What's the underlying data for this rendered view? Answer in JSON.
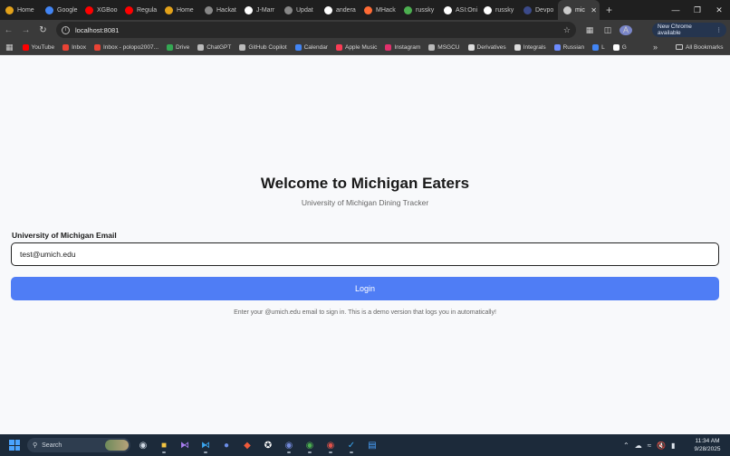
{
  "browser": {
    "tabs": [
      {
        "label": "Home",
        "color": "#e3a21a"
      },
      {
        "label": "Google",
        "color": "#4285f4"
      },
      {
        "label": "XGBoo",
        "color": "#ff0000"
      },
      {
        "label": "Regula",
        "color": "#ff0000"
      },
      {
        "label": "Home",
        "color": "#e3a21a"
      },
      {
        "label": "Hackat",
        "color": "#888888"
      },
      {
        "label": "J-Marr",
        "color": "#ffffff"
      },
      {
        "label": "Updat",
        "color": "#888888"
      },
      {
        "label": "andera",
        "color": "#ffffff"
      },
      {
        "label": "MHack",
        "color": "#ff6b35"
      },
      {
        "label": "russky",
        "color": "#4caf50"
      },
      {
        "label": "ASI:Oni",
        "color": "#ffffff"
      },
      {
        "label": "russky",
        "color": "#ffffff"
      },
      {
        "label": "Devpo",
        "color": "#3b4a8a"
      },
      {
        "label": "mic",
        "color": "#cccccc"
      }
    ],
    "url": "localhost:8081",
    "profile_initial": "A",
    "update_label": "New Chrome available",
    "bookmarks": [
      {
        "label": "YouTube",
        "color": "#ff0000"
      },
      {
        "label": "Inbox",
        "color": "#ea4335"
      },
      {
        "label": "Inbox - polopo2007...",
        "color": "#ea4335"
      },
      {
        "label": "Drive",
        "color": "#34a853"
      },
      {
        "label": "ChatGPT",
        "color": "#bbbbbb"
      },
      {
        "label": "GitHub Copilot",
        "color": "#bbbbbb"
      },
      {
        "label": "Calendar",
        "color": "#4285f4"
      },
      {
        "label": "Apple Music",
        "color": "#fa3c55"
      },
      {
        "label": "Instagram",
        "color": "#e1306c"
      },
      {
        "label": "MSGCU",
        "color": "#bbbbbb"
      },
      {
        "label": "Derivatives",
        "color": "#dddddd"
      },
      {
        "label": "Integrals",
        "color": "#dddddd"
      },
      {
        "label": "Russian",
        "color": "#6d8cff"
      },
      {
        "label": "L",
        "color": "#4285f4"
      },
      {
        "label": "G",
        "color": "#ffffff"
      }
    ],
    "all_bookmarks_label": "All Bookmarks"
  },
  "page": {
    "title": "Welcome to Michigan Eaters",
    "subtitle": "University of Michigan Dining Tracker",
    "email_label": "University of Michigan Email",
    "email_value": "test@umich.edu",
    "login_label": "Login",
    "hint": "Enter your @umich.edu email to sign in. This is a demo version that logs you in automatically!",
    "accent_color": "#4f7df5"
  },
  "taskbar": {
    "search_label": "Search",
    "time": "11:34 AM",
    "date": "9/28/2025"
  }
}
